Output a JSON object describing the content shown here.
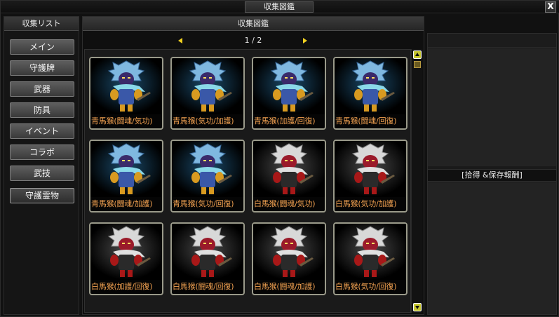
{
  "window": {
    "title": "収集図鑑",
    "close_label": "X"
  },
  "sidebar": {
    "header": "収集リスト",
    "items": [
      {
        "label": "メイン",
        "active": false
      },
      {
        "label": "守護牌",
        "active": false
      },
      {
        "label": "武器",
        "active": false
      },
      {
        "label": "防具",
        "active": false
      },
      {
        "label": "イベント",
        "active": false
      },
      {
        "label": "コラボ",
        "active": false
      },
      {
        "label": "武技",
        "active": false
      },
      {
        "label": "守護霊物",
        "active": true
      }
    ]
  },
  "main": {
    "header": "収集図鑑",
    "pager": {
      "text": "1 / 2",
      "current": 1,
      "total": 2
    }
  },
  "cards": [
    {
      "label": "青馬猴(闘魂/気功)",
      "variant": "blue"
    },
    {
      "label": "青馬猴(気功/加護)",
      "variant": "blue"
    },
    {
      "label": "青馬猴(加護/回復)",
      "variant": "blue"
    },
    {
      "label": "青馬猴(闘魂/回復)",
      "variant": "blue"
    },
    {
      "label": "青馬猴(闘魂/加護)",
      "variant": "blue"
    },
    {
      "label": "青馬猴(気功/回復)",
      "variant": "blue"
    },
    {
      "label": "白馬猴(闘魂/気功)",
      "variant": "white"
    },
    {
      "label": "白馬猴(気功/加護)",
      "variant": "white"
    },
    {
      "label": "白馬猴(加護/回復)",
      "variant": "white"
    },
    {
      "label": "白馬猴(闘魂/回復)",
      "variant": "white"
    },
    {
      "label": "白馬猴(闘魂/加護)",
      "variant": "white"
    },
    {
      "label": "白馬猴(気功/回復)",
      "variant": "white"
    }
  ],
  "right_panel": {
    "header": "[拾得 &保存報酬]"
  },
  "colors": {
    "label_text": "#f0a050",
    "pager_arrow": "#f0d020",
    "scroll_button": "#c8c830"
  }
}
